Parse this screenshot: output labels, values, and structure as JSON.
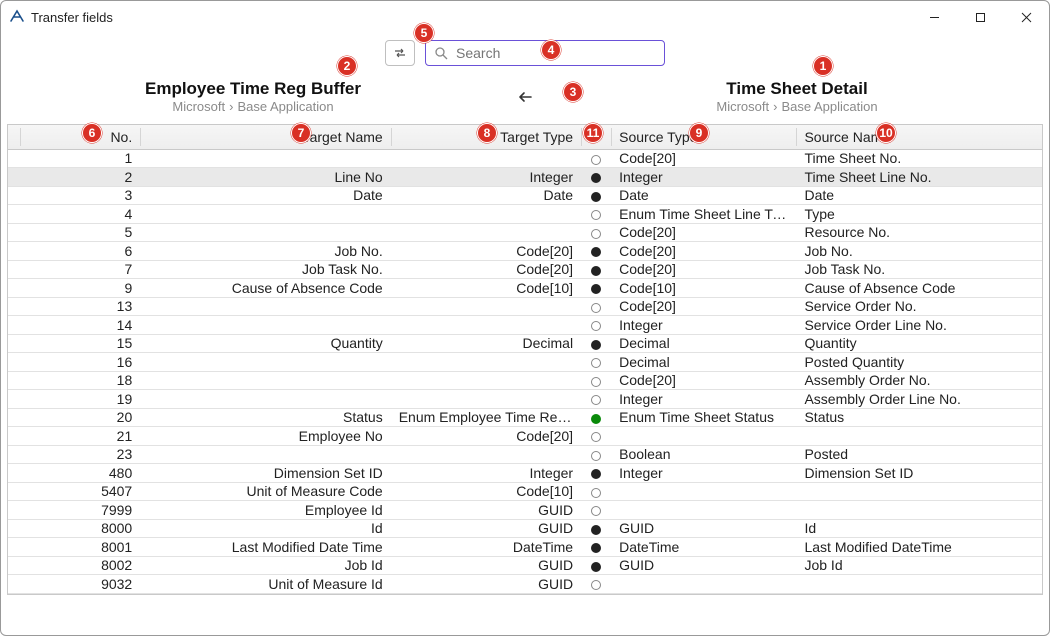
{
  "window": {
    "title": "Transfer fields"
  },
  "search": {
    "placeholder": "Search"
  },
  "left": {
    "title": "Employee Time Reg Buffer",
    "path1": "Microsoft",
    "path2": "Base Application"
  },
  "right": {
    "title": "Time Sheet Detail",
    "path1": "Microsoft",
    "path2": "Base Application"
  },
  "columns": {
    "no": "No.",
    "targetName": "Target Name",
    "targetType": "Target Type",
    "sourceType": "Source Type",
    "sourceName": "Source Name"
  },
  "rows": [
    {
      "no": "1",
      "tn": "",
      "tt": "",
      "state": "empty",
      "st": "Code[20]",
      "sn": "Time Sheet No."
    },
    {
      "no": "2",
      "tn": "Line No",
      "tt": "Integer",
      "state": "full",
      "st": "Integer",
      "sn": "Time Sheet Line No.",
      "selected": true
    },
    {
      "no": "3",
      "tn": "Date",
      "tt": "Date",
      "state": "full",
      "st": "Date",
      "sn": "Date"
    },
    {
      "no": "4",
      "tn": "",
      "tt": "",
      "state": "empty",
      "st": "Enum Time Sheet Line Type",
      "sn": "Type"
    },
    {
      "no": "5",
      "tn": "",
      "tt": "",
      "state": "empty",
      "st": "Code[20]",
      "sn": "Resource No."
    },
    {
      "no": "6",
      "tn": "Job No.",
      "tt": "Code[20]",
      "state": "full",
      "st": "Code[20]",
      "sn": "Job No."
    },
    {
      "no": "7",
      "tn": "Job Task No.",
      "tt": "Code[20]",
      "state": "full",
      "st": "Code[20]",
      "sn": "Job Task No."
    },
    {
      "no": "9",
      "tn": "Cause of Absence Code",
      "tt": "Code[10]",
      "state": "full",
      "st": "Code[10]",
      "sn": "Cause of Absence Code"
    },
    {
      "no": "13",
      "tn": "",
      "tt": "",
      "state": "empty",
      "st": "Code[20]",
      "sn": "Service Order No."
    },
    {
      "no": "14",
      "tn": "",
      "tt": "",
      "state": "empty",
      "st": "Integer",
      "sn": "Service Order Line No."
    },
    {
      "no": "15",
      "tn": "Quantity",
      "tt": "Decimal",
      "state": "full",
      "st": "Decimal",
      "sn": "Quantity"
    },
    {
      "no": "16",
      "tn": "",
      "tt": "",
      "state": "empty",
      "st": "Decimal",
      "sn": "Posted Quantity"
    },
    {
      "no": "18",
      "tn": "",
      "tt": "",
      "state": "empty",
      "st": "Code[20]",
      "sn": "Assembly Order No."
    },
    {
      "no": "19",
      "tn": "",
      "tt": "",
      "state": "empty",
      "st": "Integer",
      "sn": "Assembly Order Line No."
    },
    {
      "no": "20",
      "tn": "Status",
      "tt": "Enum Employee Time Reg. Status",
      "state": "green",
      "st": "Enum Time Sheet Status",
      "sn": "Status"
    },
    {
      "no": "21",
      "tn": "Employee No",
      "tt": "Code[20]",
      "state": "empty",
      "st": "",
      "sn": ""
    },
    {
      "no": "23",
      "tn": "",
      "tt": "",
      "state": "empty",
      "st": "Boolean",
      "sn": "Posted"
    },
    {
      "no": "480",
      "tn": "Dimension Set ID",
      "tt": "Integer",
      "state": "full",
      "st": "Integer",
      "sn": "Dimension Set ID"
    },
    {
      "no": "5407",
      "tn": "Unit of Measure Code",
      "tt": "Code[10]",
      "state": "empty",
      "st": "",
      "sn": ""
    },
    {
      "no": "7999",
      "tn": "Employee Id",
      "tt": "GUID",
      "state": "empty",
      "st": "",
      "sn": ""
    },
    {
      "no": "8000",
      "tn": "Id",
      "tt": "GUID",
      "state": "full",
      "st": "GUID",
      "sn": "Id"
    },
    {
      "no": "8001",
      "tn": "Last Modified Date Time",
      "tt": "DateTime",
      "state": "full",
      "st": "DateTime",
      "sn": "Last Modified DateTime"
    },
    {
      "no": "8002",
      "tn": "Job Id",
      "tt": "GUID",
      "state": "full",
      "st": "GUID",
      "sn": "Job Id"
    },
    {
      "no": "9032",
      "tn": "Unit of Measure Id",
      "tt": "GUID",
      "state": "empty",
      "st": "",
      "sn": ""
    }
  ],
  "badges": {
    "1": "1",
    "2": "2",
    "3": "3",
    "4": "4",
    "5": "5",
    "6": "6",
    "7": "7",
    "8": "8",
    "9": "9",
    "10": "10",
    "11": "11"
  }
}
